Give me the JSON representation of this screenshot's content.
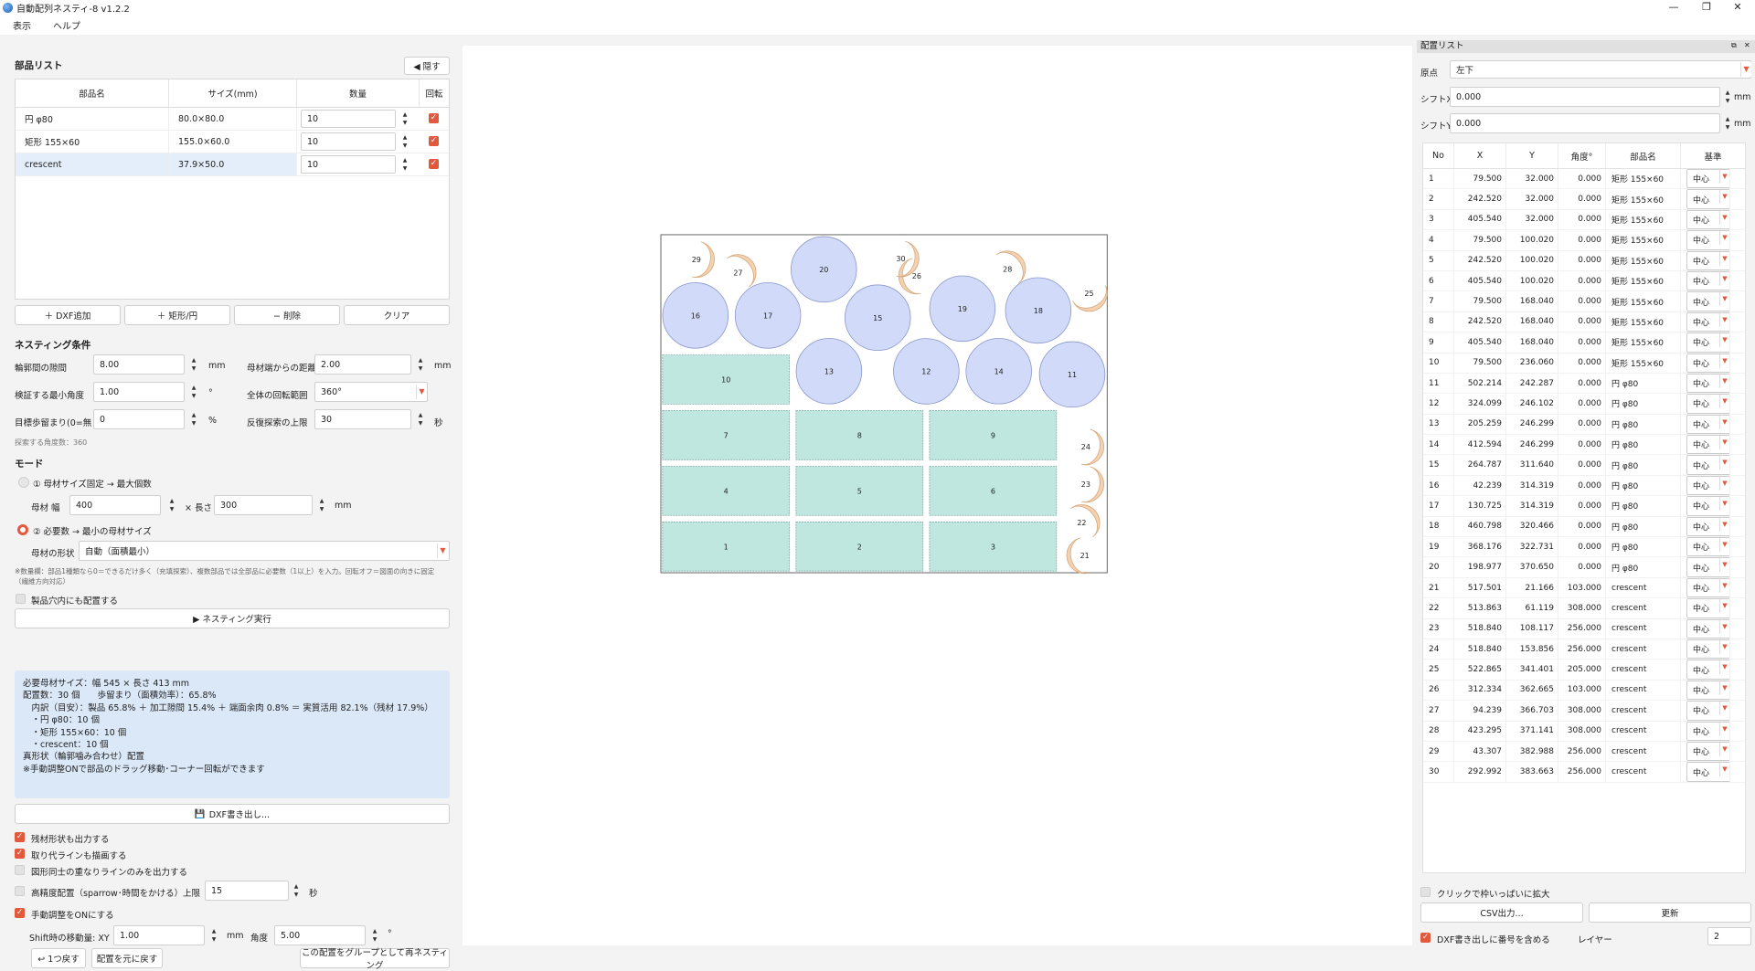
{
  "window": {
    "title": "自動配列ネスティ-8 v1.2.2",
    "minimize": "—",
    "restore": "❐",
    "close": "✕"
  },
  "menu": [
    "表示",
    "ヘルプ"
  ],
  "parts": {
    "title": "部品リスト",
    "hide_button": "◀ 隠す",
    "headers": [
      "部品名",
      "サイズ(mm)",
      "数量",
      "回転"
    ],
    "rows": [
      {
        "name": "円 φ80",
        "size": "80.0×80.0",
        "qty": "10",
        "rotate": true
      },
      {
        "name": "矩形 155×60",
        "size": "155.0×60.0",
        "qty": "10",
        "rotate": true
      },
      {
        "name": "crescent",
        "size": "37.9×50.0",
        "qty": "10",
        "rotate": true
      }
    ],
    "buttons": [
      "＋ DXF追加",
      "＋ 矩形/円",
      "− 削除",
      "クリア"
    ]
  },
  "nesting": {
    "title": "ネスティング条件",
    "gap_label": "輪郭間の隙間",
    "gap_value": "8.00",
    "gap_unit": "mm",
    "edge_label": "母材端からの距離",
    "edge_value": "2.00",
    "edge_unit": "mm",
    "angle_label": "検証する最小角度",
    "angle_value": "1.00",
    "angle_unit": "°",
    "rot_label": "全体の回転範囲",
    "rot_value": "360°",
    "yield_label": "目標歩留まり(0=無",
    "yield_value": "0",
    "yield_unit": "%",
    "iter_label": "反復探索の上限",
    "iter_value": "30",
    "iter_unit": "秒",
    "angles_note": "探索する角度数：360"
  },
  "mode": {
    "title": "モード",
    "opt1": "① 母材サイズ固定 → 最大個数",
    "width_label": "母材 幅",
    "width_value": "400",
    "length_label": "× 長さ",
    "length_value": "300",
    "size_unit": "mm",
    "opt2": "② 必要数 → 最小の母材サイズ",
    "shape_label": "母材の形状",
    "shape_value": "自動（面積最小）",
    "note": "※数量欄：部品1種類なら0＝できるだけ多く（充填探索）、複数部品では全部品に必要数（1以上）を入力。回転オフ＝図面の向きに固定\n（繊維方向対応）",
    "hole_label": "製品穴内にも配置する",
    "run_button": "▶ ネスティング実行"
  },
  "result_text": "必要母材サイズ：幅 545 × 長さ 413 mm\n配置数：30 個　　歩留まり（面積効率）：65.8%\n　内訳（目安）：製品 65.8% ＋ 加工隙間 15.4% ＋ 端面余肉 0.8% ＝ 実質活用 82.1%（残材 17.9%）\n　・円 φ80：10 個\n　・矩形 155×60：10 個\n　・crescent：10 個\n真形状（輪郭噛み合わせ）配置\n※手動調整ONで部品のドラッグ移動･コーナー回転ができます",
  "export": {
    "dxf_button": "DXF書き出し...",
    "opt_remnant": "残材形状も出力する",
    "opt_margin": "取り代ラインも描画する",
    "opt_overlap": "図形同士の重なりラインのみを出力する",
    "opt_precise": "高精度配置（sparrow･時間をかける）",
    "limit_label": "上限",
    "limit_value": "15",
    "limit_unit": "秒",
    "opt_manual": "手動調整をONにする",
    "shift_label": "Shift時の移動量: XY",
    "shift_value": "1.00",
    "shift_unit": "mm",
    "angle_label": "角度",
    "angle_value": "5.00",
    "angle_unit": "°",
    "undo_button": "↩ 1つ戻す",
    "reset_button": "配置を元に戻す",
    "group_button": "この配置をグループとして再ネスティング"
  },
  "colors": {
    "accent": "#e2593d",
    "rect_fill": "#bfe6df",
    "circle_fill": "#d1daf9",
    "crescent_fill": "#f3d2b2"
  },
  "nest_shapes": {
    "rects": [
      "1",
      "2",
      "3",
      "4",
      "5",
      "6",
      "7",
      "8",
      "9",
      "10"
    ],
    "circles": [
      "11",
      "12",
      "13",
      "14",
      "15",
      "16",
      "17",
      "18",
      "19",
      "20"
    ],
    "crescents": [
      "21",
      "22",
      "23",
      "24",
      "25",
      "26",
      "27",
      "28",
      "29",
      "30"
    ]
  },
  "placement": {
    "title": "配置リスト",
    "origin_label": "原点",
    "origin_value": "左下",
    "shiftx_label": "シフトX",
    "shiftx_value": "0.000",
    "shifty_label": "シフトY",
    "shifty_value": "0.000",
    "unit": "mm",
    "headers": [
      "No",
      "X",
      "Y",
      "角度°",
      "部品名",
      "基準"
    ],
    "rows": [
      [
        "1",
        "79.500",
        "32.000",
        "0.000",
        "矩形 155×60",
        "中心"
      ],
      [
        "2",
        "242.520",
        "32.000",
        "0.000",
        "矩形 155×60",
        "中心"
      ],
      [
        "3",
        "405.540",
        "32.000",
        "0.000",
        "矩形 155×60",
        "中心"
      ],
      [
        "4",
        "79.500",
        "100.020",
        "0.000",
        "矩形 155×60",
        "中心"
      ],
      [
        "5",
        "242.520",
        "100.020",
        "0.000",
        "矩形 155×60",
        "中心"
      ],
      [
        "6",
        "405.540",
        "100.020",
        "0.000",
        "矩形 155×60",
        "中心"
      ],
      [
        "7",
        "79.500",
        "168.040",
        "0.000",
        "矩形 155×60",
        "中心"
      ],
      [
        "8",
        "242.520",
        "168.040",
        "0.000",
        "矩形 155×60",
        "中心"
      ],
      [
        "9",
        "405.540",
        "168.040",
        "0.000",
        "矩形 155×60",
        "中心"
      ],
      [
        "10",
        "79.500",
        "236.060",
        "0.000",
        "矩形 155×60",
        "中心"
      ],
      [
        "11",
        "502.214",
        "242.287",
        "0.000",
        "円 φ80",
        "中心"
      ],
      [
        "12",
        "324.099",
        "246.102",
        "0.000",
        "円 φ80",
        "中心"
      ],
      [
        "13",
        "205.259",
        "246.299",
        "0.000",
        "円 φ80",
        "中心"
      ],
      [
        "14",
        "412.594",
        "246.299",
        "0.000",
        "円 φ80",
        "中心"
      ],
      [
        "15",
        "264.787",
        "311.640",
        "0.000",
        "円 φ80",
        "中心"
      ],
      [
        "16",
        "42.239",
        "314.319",
        "0.000",
        "円 φ80",
        "中心"
      ],
      [
        "17",
        "130.725",
        "314.319",
        "0.000",
        "円 φ80",
        "中心"
      ],
      [
        "18",
        "460.798",
        "320.466",
        "0.000",
        "円 φ80",
        "中心"
      ],
      [
        "19",
        "368.176",
        "322.731",
        "0.000",
        "円 φ80",
        "中心"
      ],
      [
        "20",
        "198.977",
        "370.650",
        "0.000",
        "円 φ80",
        "中心"
      ],
      [
        "21",
        "517.501",
        "21.166",
        "103.000",
        "crescent",
        "中心"
      ],
      [
        "22",
        "513.863",
        "61.119",
        "308.000",
        "crescent",
        "中心"
      ],
      [
        "23",
        "518.840",
        "108.117",
        "256.000",
        "crescent",
        "中心"
      ],
      [
        "24",
        "518.840",
        "153.856",
        "256.000",
        "crescent",
        "中心"
      ],
      [
        "25",
        "522.865",
        "341.401",
        "205.000",
        "crescent",
        "中心"
      ],
      [
        "26",
        "312.334",
        "362.665",
        "103.000",
        "crescent",
        "中心"
      ],
      [
        "27",
        "94.239",
        "366.703",
        "308.000",
        "crescent",
        "中心"
      ],
      [
        "28",
        "423.295",
        "371.141",
        "308.000",
        "crescent",
        "中心"
      ],
      [
        "29",
        "43.307",
        "382.988",
        "256.000",
        "crescent",
        "中心"
      ],
      [
        "30",
        "292.992",
        "383.663",
        "256.000",
        "crescent",
        "中心"
      ]
    ],
    "zoom_label": "クリックで枠いっぱいに拡大",
    "csv_button": "CSV出力...",
    "refresh_button": "更新",
    "dxf_num_label": "DXF書き出しに番号を含める",
    "layer_label": "レイヤー",
    "layer_value": "2"
  }
}
